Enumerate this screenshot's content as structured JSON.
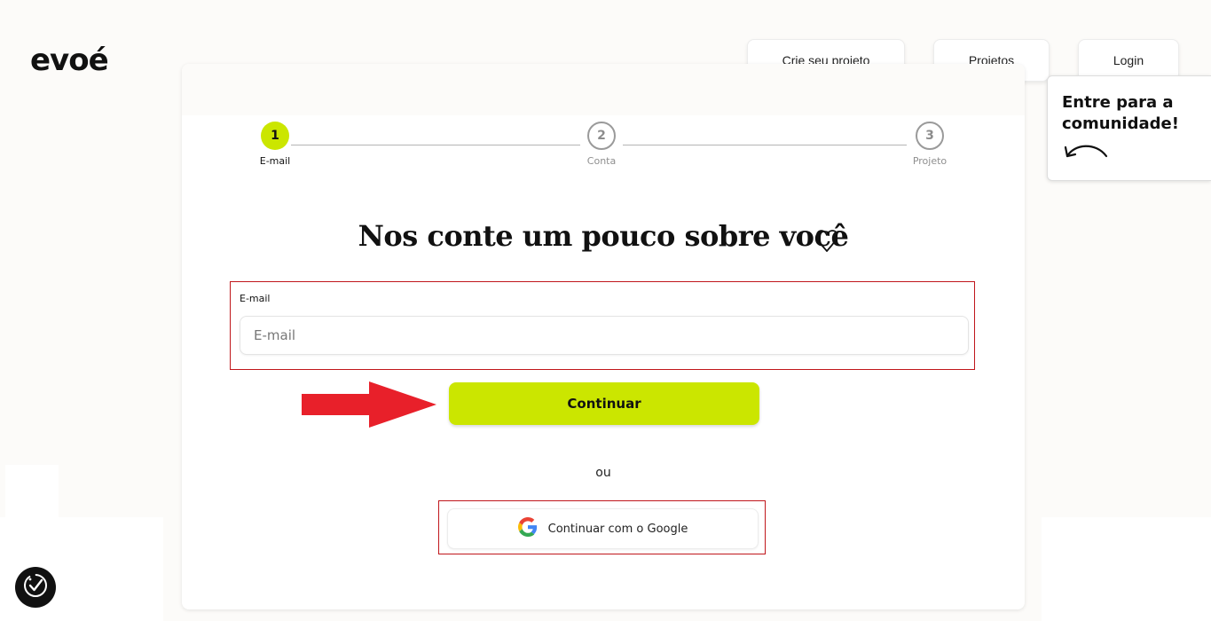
{
  "brand": {
    "logo_text": "evoé"
  },
  "nav": {
    "create_project": "Crie seu projeto",
    "projects": "Projetos",
    "login": "Login"
  },
  "tooltip": {
    "text": "Entre para a comunidade!",
    "icon": "curved-arrow-left-icon"
  },
  "stepper": {
    "steps": [
      {
        "number": "1",
        "label": "E-mail",
        "state": "active"
      },
      {
        "number": "2",
        "label": "Conta",
        "state": "inactive"
      },
      {
        "number": "3",
        "label": "Projeto",
        "state": "inactive"
      }
    ]
  },
  "form": {
    "headline": "Nos conte um pouco sobre você",
    "headline_icon": "heart-icon",
    "email_label": "E-mail",
    "email_placeholder": "E-mail",
    "email_value": "",
    "continue_label": "Continuar",
    "divider_text": "ou",
    "google_label": "Continuar com o Google"
  },
  "colors": {
    "accent": "#cbe600",
    "annotation_red": "#e8202a",
    "highlight_border": "#c0161b"
  },
  "annotations": {
    "arrow": "red-pointer-arrow-icon"
  },
  "accessibility": {
    "icon": "accessibility-check-icon"
  }
}
